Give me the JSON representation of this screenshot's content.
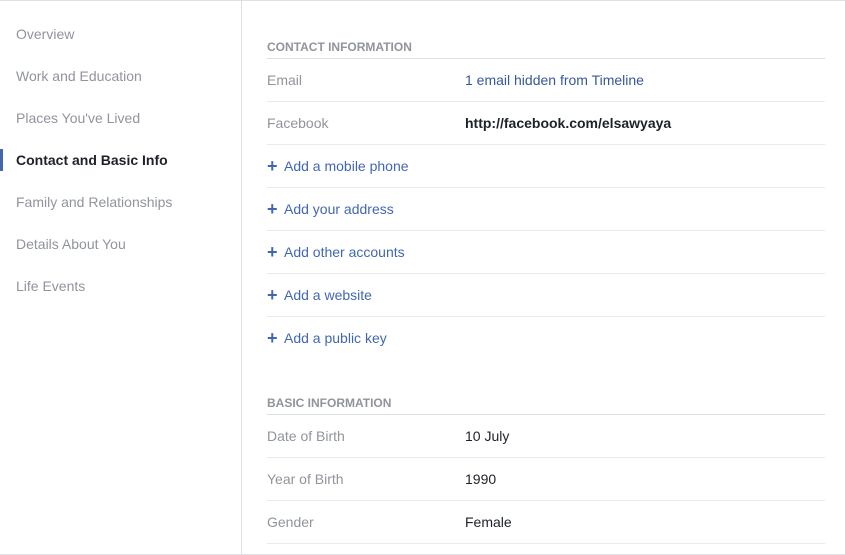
{
  "sidebar": {
    "items": [
      {
        "label": "Overview",
        "active": false
      },
      {
        "label": "Work and Education",
        "active": false
      },
      {
        "label": "Places You've Lived",
        "active": false
      },
      {
        "label": "Contact and Basic Info",
        "active": true
      },
      {
        "label": "Family and Relationships",
        "active": false
      },
      {
        "label": "Details About You",
        "active": false
      },
      {
        "label": "Life Events",
        "active": false
      }
    ]
  },
  "contact": {
    "title": "CONTACT INFORMATION",
    "email_label": "Email",
    "email_value": "1 email hidden from Timeline",
    "facebook_label": "Facebook",
    "facebook_value": "http://facebook.com/elsawyaya",
    "add_items": [
      "Add a mobile phone",
      "Add your address",
      "Add other accounts",
      "Add a website",
      "Add a public key"
    ]
  },
  "basic": {
    "title": "BASIC INFORMATION",
    "rows": [
      {
        "label": "Date of Birth",
        "value": "10 July"
      },
      {
        "label": "Year of Birth",
        "value": "1990"
      },
      {
        "label": "Gender",
        "value": "Female"
      }
    ]
  },
  "colors": {
    "accent": "#4267b2",
    "link": "#365899",
    "muted": "#90949c"
  }
}
